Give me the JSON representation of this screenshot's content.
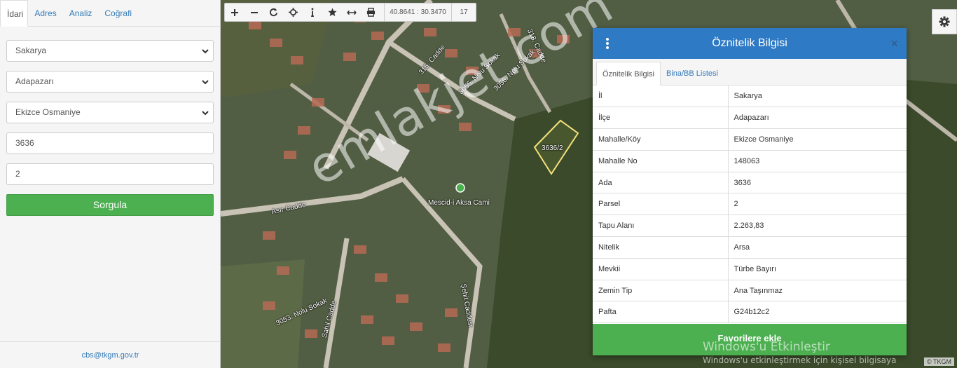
{
  "sidebar": {
    "tabs": [
      {
        "label": "İdari"
      },
      {
        "label": "Adres"
      },
      {
        "label": "Analiz"
      },
      {
        "label": "Coğrafi"
      }
    ],
    "fields": {
      "il": "Sakarya",
      "ilce": "Adapazarı",
      "mahalle": "Ekizce Osmaniye",
      "ada": "3636",
      "parsel": "2"
    },
    "query_button": "Sorgula",
    "footer_email": "cbs@tkgm.gov.tr"
  },
  "toolbar": {
    "icons": [
      "zoom-in-icon",
      "zoom-out-icon",
      "refresh-icon",
      "locate-icon",
      "info-icon",
      "favorite-icon",
      "measure-icon",
      "print-icon"
    ],
    "coords": "40.8641 : 30.3470",
    "zoom": "17"
  },
  "map": {
    "parcel_label": "3636/2",
    "streets": [
      "318. Cadde",
      "315. Cadde",
      "3055. Nolu Sokak",
      "3056. Nolu Sokak",
      "Asır Cadde",
      "Şehit Caddesi",
      "Sahil Cadde",
      "3053. Nolu Sokak"
    ],
    "poi": "Mescid-i Aksa Cami",
    "watermark": "emlakjet.com",
    "attribution_text": "© TKGM",
    "attribution_link": "TKGM"
  },
  "popup": {
    "title": "Öznitelik Bilgisi",
    "tabs": [
      {
        "label": "Öznitelik Bilgisi"
      },
      {
        "label": "Bina/BB Listesi"
      }
    ],
    "rows": [
      {
        "key": "İl",
        "value": "Sakarya"
      },
      {
        "key": "İlçe",
        "value": "Adapazarı"
      },
      {
        "key": "Mahalle/Köy",
        "value": "Ekizce Osmaniye"
      },
      {
        "key": "Mahalle No",
        "value": "148063"
      },
      {
        "key": "Ada",
        "value": "3636"
      },
      {
        "key": "Parsel",
        "value": "2"
      },
      {
        "key": "Tapu Alanı",
        "value": "2.263,83"
      },
      {
        "key": "Nitelik",
        "value": "Arsa"
      },
      {
        "key": "Mevkii",
        "value": "Türbe Bayırı"
      },
      {
        "key": "Zemin Tip",
        "value": "Ana Taşınmaz"
      },
      {
        "key": "Pafta",
        "value": "G24b12c2"
      }
    ],
    "favorite_button": "Favorilere ekle",
    "close_glyph": "×"
  },
  "windows_activation": {
    "title": "Windows'u Etkinleştir",
    "subtitle": "Windows'u etkinleştirmek için kişisel bilgisaya"
  },
  "colors": {
    "header_blue": "#2f7ac4",
    "button_green": "#4caf50",
    "link_blue": "#337ab7"
  }
}
